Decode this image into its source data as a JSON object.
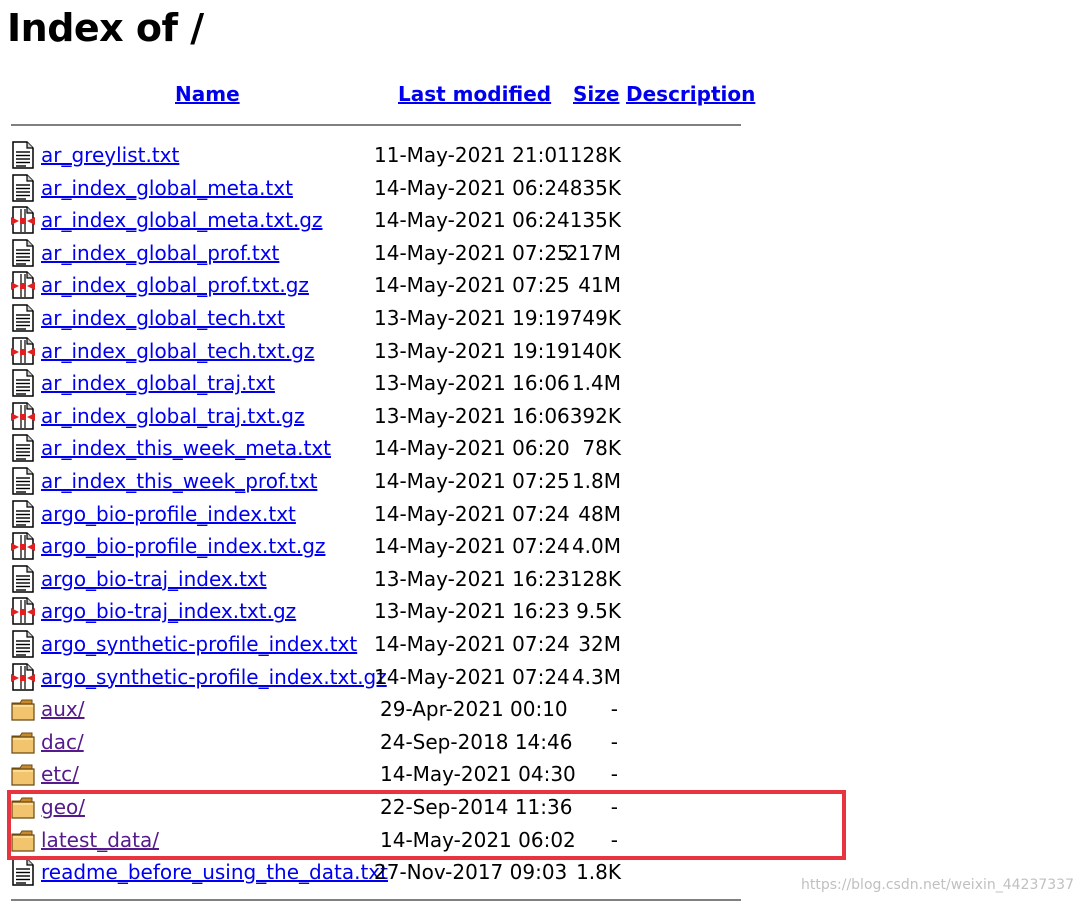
{
  "page": {
    "title": "Index of /",
    "watermark": "https://blog.csdn.net/weixin_44237337"
  },
  "columns": {
    "name": "Name",
    "modified": "Last modified",
    "size": "Size",
    "description": "Description"
  },
  "entries": [
    {
      "name": "ar_greylist.txt",
      "modified": "11-May-2021 21:01",
      "size": "128K",
      "icon": "text-file-icon"
    },
    {
      "name": "ar_index_global_meta.txt",
      "modified": "14-May-2021 06:24",
      "size": "835K",
      "icon": "text-file-icon"
    },
    {
      "name": "ar_index_global_meta.txt.gz",
      "modified": "14-May-2021 06:24",
      "size": "135K",
      "icon": "compressed-file-icon"
    },
    {
      "name": "ar_index_global_prof.txt",
      "modified": "14-May-2021 07:25",
      "size": "217M",
      "icon": "text-file-icon"
    },
    {
      "name": "ar_index_global_prof.txt.gz",
      "modified": "14-May-2021 07:25",
      "size": "41M",
      "icon": "compressed-file-icon"
    },
    {
      "name": "ar_index_global_tech.txt",
      "modified": "13-May-2021 19:19",
      "size": "749K",
      "icon": "text-file-icon"
    },
    {
      "name": "ar_index_global_tech.txt.gz",
      "modified": "13-May-2021 19:19",
      "size": "140K",
      "icon": "compressed-file-icon"
    },
    {
      "name": "ar_index_global_traj.txt",
      "modified": "13-May-2021 16:06",
      "size": "1.4M",
      "icon": "text-file-icon"
    },
    {
      "name": "ar_index_global_traj.txt.gz",
      "modified": "13-May-2021 16:06",
      "size": "392K",
      "icon": "compressed-file-icon"
    },
    {
      "name": "ar_index_this_week_meta.txt",
      "modified": "14-May-2021 06:20",
      "size": "78K",
      "icon": "text-file-icon"
    },
    {
      "name": "ar_index_this_week_prof.txt",
      "modified": "14-May-2021 07:25",
      "size": "1.8M",
      "icon": "text-file-icon"
    },
    {
      "name": "argo_bio-profile_index.txt",
      "modified": "14-May-2021 07:24",
      "size": "48M",
      "icon": "text-file-icon"
    },
    {
      "name": "argo_bio-profile_index.txt.gz",
      "modified": "14-May-2021 07:24",
      "size": "4.0M",
      "icon": "compressed-file-icon"
    },
    {
      "name": "argo_bio-traj_index.txt",
      "modified": "13-May-2021 16:23",
      "size": "128K",
      "icon": "text-file-icon"
    },
    {
      "name": "argo_bio-traj_index.txt.gz",
      "modified": "13-May-2021 16:23",
      "size": "9.5K",
      "icon": "compressed-file-icon"
    },
    {
      "name": "argo_synthetic-profile_index.txt",
      "modified": "14-May-2021 07:24",
      "size": "32M",
      "icon": "text-file-icon"
    },
    {
      "name": "argo_synthetic-profile_index.txt.gz",
      "modified": "14-May-2021 07:24",
      "size": "4.3M",
      "icon": "compressed-file-icon"
    },
    {
      "name": "aux/",
      "modified": "29-Apr-2021 00:10",
      "size": "-",
      "icon": "folder-icon"
    },
    {
      "name": "dac/",
      "modified": "24-Sep-2018 14:46",
      "size": "-",
      "icon": "folder-icon"
    },
    {
      "name": "etc/",
      "modified": "14-May-2021 04:30",
      "size": "-",
      "icon": "folder-icon"
    },
    {
      "name": "geo/",
      "modified": "22-Sep-2014 11:36",
      "size": "-",
      "icon": "folder-icon"
    },
    {
      "name": "latest_data/",
      "modified": "14-May-2021 06:02",
      "size": "-",
      "icon": "folder-icon"
    },
    {
      "name": "readme_before_using_the_data.txt",
      "modified": "27-Nov-2017 09:03",
      "size": "1.8K",
      "icon": "text-file-icon"
    }
  ],
  "colors": {
    "link": "#0000ee",
    "visited_link": "#551a8b",
    "highlight_border": "#e8343f",
    "rule": "#808080"
  }
}
